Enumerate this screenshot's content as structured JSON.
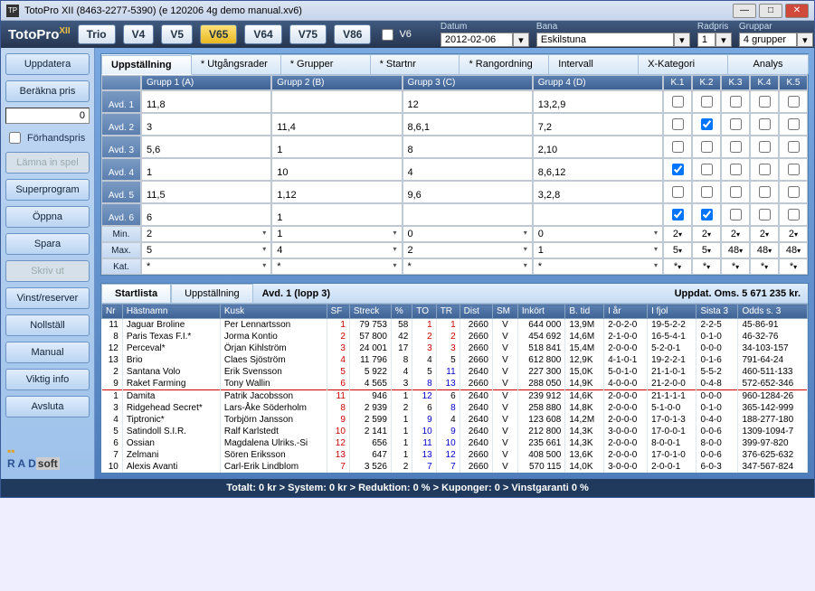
{
  "title": "TotoPro XII (8463-2277-5390)   (e 120206 4g demo manual.xv6)",
  "logo": "TotoPro",
  "logo_sup": "XII",
  "top_buttons": [
    "Trio",
    "V4",
    "V5",
    "V65",
    "V64",
    "V75",
    "V86"
  ],
  "top_active_idx": 3,
  "v6_chk": "V6",
  "datum_lbl": "Datum",
  "datum": "2012-02-06",
  "bana_lbl": "Bana",
  "bana": "Eskilstuna",
  "radpris_lbl": "Radpris",
  "radpris": "1",
  "gruppar_lbl": "Gruppar",
  "gruppar": "4 grupper",
  "side": {
    "uppdatera": "Uppdatera",
    "berakna": "Beräkna pris",
    "num": "0",
    "forh": "Förhandspris",
    "lamna": "Lämna in spel",
    "super": "Superprogram",
    "oppna": "Öppna",
    "spara": "Spara",
    "skriv": "Skriv ut",
    "vinst": "Vinst/reserver",
    "noll": "Nollställ",
    "manual": "Manual",
    "viktig": "Viktig info",
    "avsluta": "Avsluta"
  },
  "upp_tabs": [
    "Uppställning",
    "* Utgångsrader",
    "* Grupper",
    "* Startnr",
    "* Rangordning",
    "Intervall",
    "X-Kategori",
    "Analys"
  ],
  "grp_heads": [
    "Grupp 1   (A)",
    "Grupp 2   (B)",
    "Grupp 3   (C)",
    "Grupp 4   (D)"
  ],
  "k_heads": [
    "K.1",
    "K.2",
    "K.3",
    "K.4",
    "K.5"
  ],
  "avd": [
    {
      "lbl": "Avd. 1",
      "v": [
        "11,8",
        "",
        "12",
        "13,2,9"
      ],
      "k": [
        false,
        false,
        false,
        false,
        false
      ]
    },
    {
      "lbl": "Avd. 2",
      "v": [
        "3",
        "11,4",
        "8,6,1",
        "7,2"
      ],
      "k": [
        false,
        true,
        false,
        false,
        false
      ]
    },
    {
      "lbl": "Avd. 3",
      "v": [
        "5,6",
        "1",
        "8",
        "2,10"
      ],
      "k": [
        false,
        false,
        false,
        false,
        false
      ]
    },
    {
      "lbl": "Avd. 4",
      "v": [
        "1",
        "10",
        "4",
        "8,6,12"
      ],
      "k": [
        true,
        false,
        false,
        false,
        false
      ]
    },
    {
      "lbl": "Avd. 5",
      "v": [
        "11,5",
        "1,12",
        "9,6",
        "3,2,8"
      ],
      "k": [
        false,
        false,
        false,
        false,
        false
      ]
    },
    {
      "lbl": "Avd. 6",
      "v": [
        "6",
        "1",
        "",
        ""
      ],
      "k": [
        true,
        true,
        false,
        false,
        false
      ]
    }
  ],
  "min": {
    "lbl": "Min.",
    "v": [
      "2",
      "1",
      "0",
      "0"
    ],
    "k": [
      "2",
      "2",
      "2",
      "2",
      "2"
    ]
  },
  "max": {
    "lbl": "Max.",
    "v": [
      "5",
      "4",
      "2",
      "1"
    ],
    "k": [
      "5",
      "5",
      "48",
      "48",
      "48"
    ]
  },
  "kat": {
    "lbl": "Kat.",
    "v": [
      "*",
      "*",
      "*",
      "*"
    ],
    "k": [
      "*",
      "*",
      "*",
      "*",
      "*"
    ]
  },
  "sl_tabs": [
    "Startlista",
    "Uppställning"
  ],
  "avd_label": "Avd. 1 (lopp 3)",
  "uppdat": "Uppdat.  Oms. 5 671 235 kr.",
  "cols": [
    "Nr",
    "Hästnamn",
    "Kusk",
    "SF",
    "Streck",
    "%",
    "TO",
    "TR",
    "Dist",
    "SM",
    "Inkört",
    "B. tid",
    "I år",
    "I fjol",
    "Sista 3",
    "Odds s. 3"
  ],
  "rows": [
    [
      "11",
      "Jaguar Broline",
      "Per Lennartsson",
      "1",
      "79 753",
      "58",
      "1",
      "1",
      "2660",
      "V",
      "644 000",
      "13,9M",
      "2-0-2-0",
      "19-5-2-2",
      "2-2-5",
      "45-86-91"
    ],
    [
      "8",
      "Paris Texas F.I.*",
      "Jorma Kontio",
      "2",
      "57 800",
      "42",
      "2",
      "2",
      "2660",
      "V",
      "454 692",
      "14,6M",
      "2-1-0-0",
      "16-5-4-1",
      "0-1-0",
      "46-32-76"
    ],
    [
      "12",
      "Perceval*",
      "Örjan Kihlström",
      "3",
      "24 001",
      "17",
      "3",
      "3",
      "2660",
      "V",
      "518 841",
      "15,4M",
      "2-0-0-0",
      "5-2-0-1",
      "0-0-0",
      "34-103-157"
    ],
    [
      "13",
      "Brio",
      "Claes Sjöström",
      "4",
      "11 796",
      "8",
      "4",
      "5",
      "2660",
      "V",
      "612 800",
      "12,9K",
      "4-1-0-1",
      "19-2-2-1",
      "0-1-6",
      "791-64-24"
    ],
    [
      "2",
      "Santana Volo",
      "Erik Svensson",
      "5",
      "5 922",
      "4",
      "5",
      "11",
      "2640",
      "V",
      "227 300",
      "15,0K",
      "5-0-1-0",
      "21-1-0-1",
      "5-5-2",
      "460-511-133"
    ],
    [
      "9",
      "Raket Farming",
      "Tony Wallin",
      "6",
      "4 565",
      "3",
      "8",
      "13",
      "2660",
      "V",
      "288 050",
      "14,9K",
      "4-0-0-0",
      "21-2-0-0",
      "0-4-8",
      "572-652-346"
    ],
    [
      "1",
      "Damita",
      "Patrik Jacobsson",
      "11",
      "946",
      "1",
      "12",
      "6",
      "2640",
      "V",
      "239 912",
      "14,6K",
      "2-0-0-0",
      "21-1-1-1",
      "0-0-0",
      "960-1284-26"
    ],
    [
      "3",
      "Ridgehead Secret*",
      "Lars-Åke Söderholm",
      "8",
      "2 939",
      "2",
      "6",
      "8",
      "2640",
      "V",
      "258 880",
      "14,8K",
      "2-0-0-0",
      "5-1-0-0",
      "0-1-0",
      "365-142-999"
    ],
    [
      "4",
      "Tiptronic*",
      "Torbjörn Jansson",
      "9",
      "2 599",
      "1",
      "9",
      "4",
      "2640",
      "V",
      "123 608",
      "14,2M",
      "2-0-0-0",
      "17-0-1-3",
      "0-4-0",
      "188-277-180"
    ],
    [
      "5",
      "Satindoll S.I.R.",
      "Ralf Karlstedt",
      "10",
      "2 141",
      "1",
      "10",
      "9",
      "2640",
      "V",
      "212 800",
      "14,3K",
      "3-0-0-0",
      "17-0-0-1",
      "0-0-6",
      "1309-1094-7"
    ],
    [
      "6",
      "Ossian",
      "Magdalena Ulriks.-Si",
      "12",
      "656",
      "1",
      "11",
      "10",
      "2640",
      "V",
      "235 661",
      "14,3K",
      "2-0-0-0",
      "8-0-0-1",
      "8-0-0",
      "399-97-820"
    ],
    [
      "7",
      "Zelmani",
      "Sören Eriksson",
      "13",
      "647",
      "1",
      "13",
      "12",
      "2660",
      "V",
      "408 500",
      "13,6K",
      "2-0-0-0",
      "17-0-1-0",
      "0-0-6",
      "376-625-632"
    ],
    [
      "10",
      "Alexis Avanti",
      "Carl-Erik Lindblom",
      "7",
      "3 526",
      "2",
      "7",
      "7",
      "2660",
      "V",
      "570 115",
      "14,0K",
      "3-0-0-0",
      "2-0-0-1",
      "6-0-3",
      "347-567-824"
    ]
  ],
  "status": "Totalt: 0 kr > System: 0 kr > Reduktion: 0 % > Kuponger: 0 > Vinstgaranti 0 %"
}
